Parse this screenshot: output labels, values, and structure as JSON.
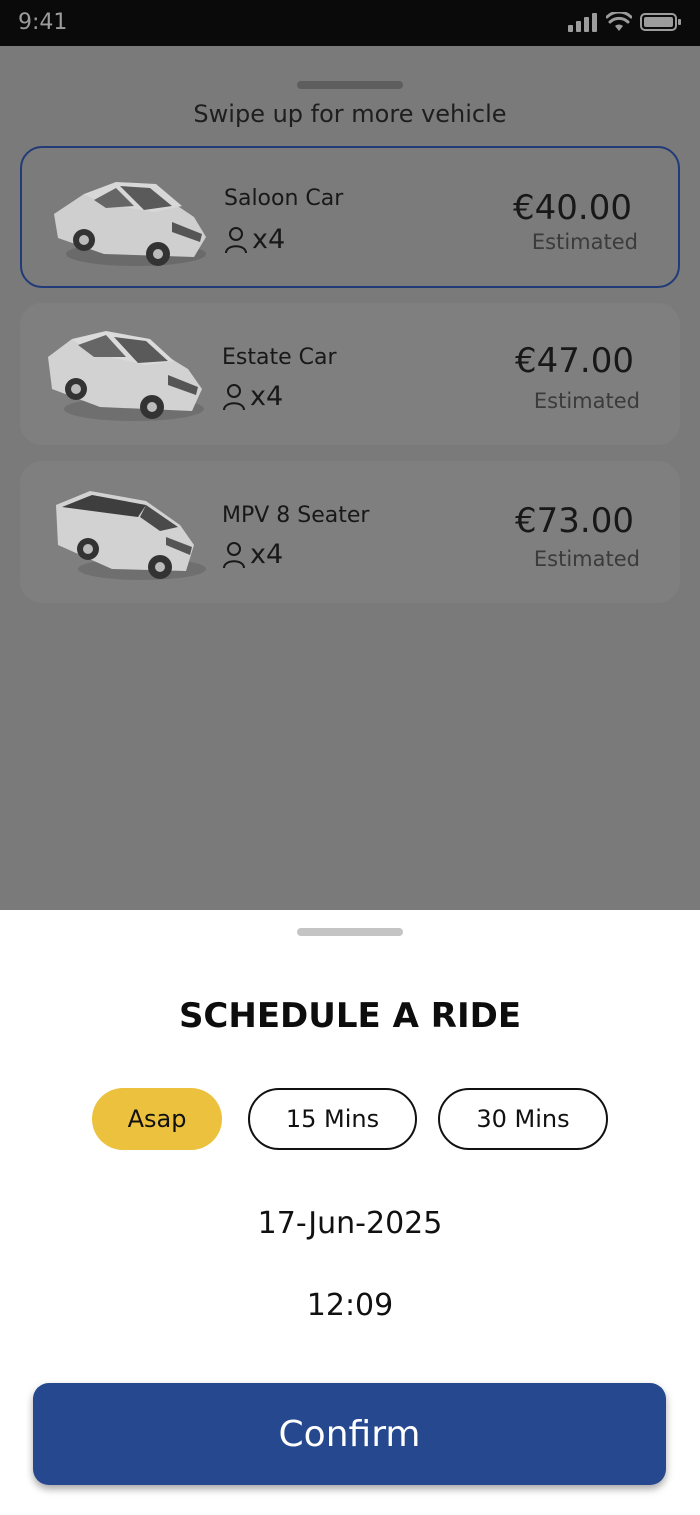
{
  "status_bar": {
    "time": "9:41"
  },
  "vehicle_list": {
    "swipe_hint": "Swipe up for more vehicle",
    "vehicles": [
      {
        "name": "Saloon Car",
        "capacity": "x4",
        "price": "€40.00",
        "price_note": "Estimated",
        "selected": true
      },
      {
        "name": "Estate Car",
        "capacity": "x4",
        "price": "€47.00",
        "price_note": "Estimated",
        "selected": false
      },
      {
        "name": "MPV 8 Seater",
        "capacity": "x4",
        "price": "€73.00",
        "price_note": "Estimated",
        "selected": false
      }
    ]
  },
  "schedule": {
    "title": "SCHEDULE A RIDE",
    "options": [
      "Asap",
      "15 Mins",
      "30 Mins"
    ],
    "selected_option": "Asap",
    "date": "17-Jun-2025",
    "time": "12:09",
    "confirm_label": "Confirm"
  },
  "colors": {
    "accent_yellow": "#ecc13e",
    "primary_blue": "#26488f",
    "selected_border": "#213a78"
  }
}
